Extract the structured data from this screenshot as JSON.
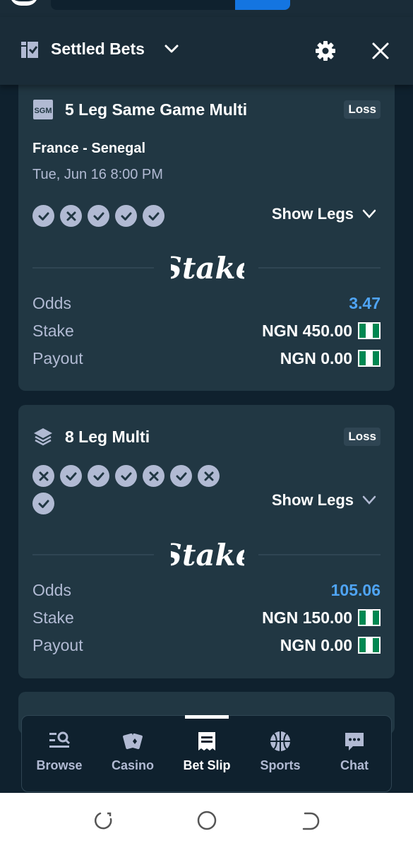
{
  "header": {
    "title": "Settled Bets"
  },
  "bets": [
    {
      "type_icon": "sgm-icon",
      "title": "5 Leg Same Game Multi",
      "status": "Loss",
      "event": "France - Senegal",
      "date": "Tue, Jun 16 8:00 PM",
      "legs": [
        "win",
        "loss",
        "win",
        "win",
        "win"
      ],
      "show_legs_label": "Show Legs",
      "brand": "Stake",
      "odds_label": "Odds",
      "odds": "3.47",
      "stake_label": "Stake",
      "stake": "NGN 450.00",
      "payout_label": "Payout",
      "payout": "NGN 0.00"
    },
    {
      "type_icon": "layers-icon",
      "title": "8 Leg Multi",
      "status": "Loss",
      "legs": [
        "loss",
        "win",
        "win",
        "win",
        "loss",
        "win",
        "loss",
        "win"
      ],
      "show_legs_label": "Show Legs",
      "brand": "Stake",
      "odds_label": "Odds",
      "odds": "105.06",
      "stake_label": "Stake",
      "stake": "NGN 150.00",
      "payout_label": "Payout",
      "payout": "NGN 0.00"
    }
  ],
  "bottom_nav": {
    "items": [
      {
        "label": "Browse",
        "icon": "browse-icon"
      },
      {
        "label": "Casino",
        "icon": "casino-cards-icon"
      },
      {
        "label": "Bet Slip",
        "icon": "bet-slip-icon",
        "active": true
      },
      {
        "label": "Sports",
        "icon": "basketball-icon"
      },
      {
        "label": "Chat",
        "icon": "chat-bubble-icon"
      }
    ]
  },
  "colors": {
    "background": "#0f212e",
    "header": "#1a2c38",
    "card": "#213743",
    "muted_text": "#b1bad3",
    "odds_blue": "#4fa4f4",
    "flag_green": "#008751"
  }
}
